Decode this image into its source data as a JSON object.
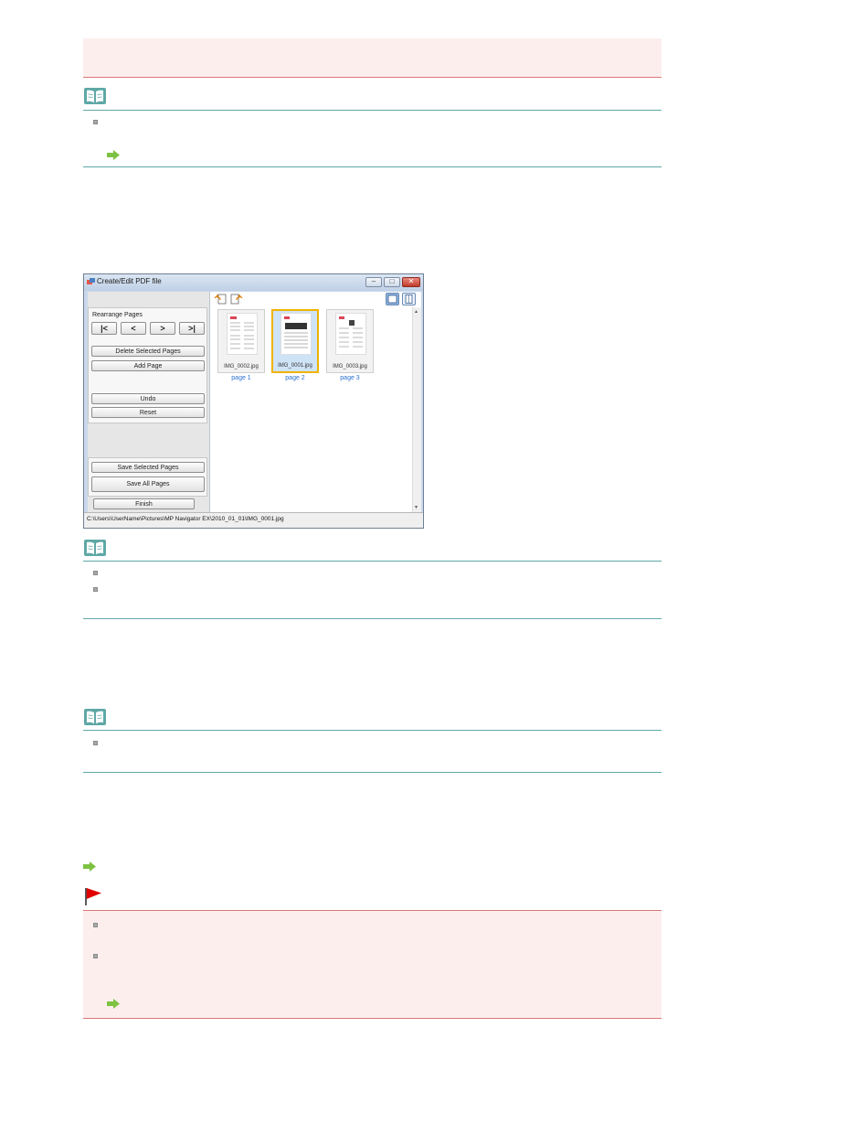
{
  "window": {
    "title": "Create/Edit PDF file",
    "rearrange_label": "Rearrange Pages",
    "nav": {
      "first": "|<",
      "prev": "<",
      "next": ">",
      "last": ">|"
    },
    "buttons": {
      "delete_selected": "Delete Selected Pages",
      "add_page": "Add Page",
      "undo": "Undo",
      "reset": "Reset",
      "save_selected": "Save Selected Pages",
      "save_all": "Save All Pages",
      "finish": "Finish"
    },
    "thumbnails": [
      {
        "filename": "IMG_0002.jpg",
        "label": "page 1",
        "selected": false
      },
      {
        "filename": "IMG_0001.jpg",
        "label": "page 2",
        "selected": true
      },
      {
        "filename": "IMG_0003.jpg",
        "label": "page 3",
        "selected": false
      }
    ],
    "status_path": "C:\\Users\\UserName\\Pictures\\MP Navigator EX\\2010_01_01\\IMG_0001.jpg"
  },
  "colors": {
    "teal_rule": "#5fa8a6",
    "pink_background": "#fdeeee",
    "pink_rule": "#d97a7a",
    "link_blue": "#2a6fd1",
    "selection_yellow": "#f0b400"
  },
  "icons": {
    "note": "open-book-icon",
    "reference": "green-arrow-icon",
    "important": "red-flag-icon"
  }
}
